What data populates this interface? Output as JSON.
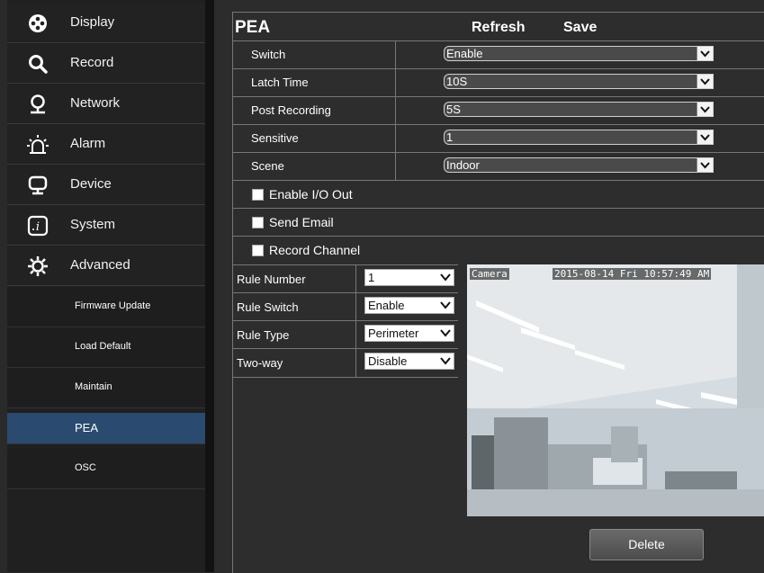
{
  "sidebar": {
    "items": [
      {
        "label": "Display",
        "icon": "display-icon"
      },
      {
        "label": "Record",
        "icon": "search-icon"
      },
      {
        "label": "Network",
        "icon": "network-icon"
      },
      {
        "label": "Alarm",
        "icon": "alarm-icon"
      },
      {
        "label": "Device",
        "icon": "monitor-icon"
      },
      {
        "label": "System",
        "icon": "system-icon"
      },
      {
        "label": "Advanced",
        "icon": "gear-icon"
      }
    ],
    "sub_items": [
      {
        "label": "Firmware Update"
      },
      {
        "label": "Load Default"
      },
      {
        "label": "Maintain"
      },
      {
        "label": "PEA",
        "active": true
      },
      {
        "label": "OSC"
      }
    ],
    "active_color": "#2b4a6f"
  },
  "header": {
    "title": "PEA",
    "refresh": "Refresh",
    "save": "Save"
  },
  "settings": [
    {
      "label": "Switch",
      "value": "Enable"
    },
    {
      "label": "Latch Time",
      "value": "10S"
    },
    {
      "label": "Post Recording",
      "value": "5S"
    },
    {
      "label": "Sensitive",
      "value": "1"
    },
    {
      "label": "Scene",
      "value": "Indoor"
    }
  ],
  "checkboxes": [
    {
      "label": "Enable I/O Out",
      "checked": false
    },
    {
      "label": "Send Email",
      "checked": false
    },
    {
      "label": "Record Channel",
      "checked": false
    }
  ],
  "rules": [
    {
      "label": "Rule Number",
      "value": "1"
    },
    {
      "label": "Rule Switch",
      "value": "Enable"
    },
    {
      "label": "Rule Type",
      "value": "Perimeter"
    },
    {
      "label": "Two-way",
      "value": "Disable"
    }
  ],
  "video": {
    "camera_label": "Camera",
    "timestamp": "2015-08-14 Fri 10:57:49 AM"
  },
  "delete_label": "Delete"
}
